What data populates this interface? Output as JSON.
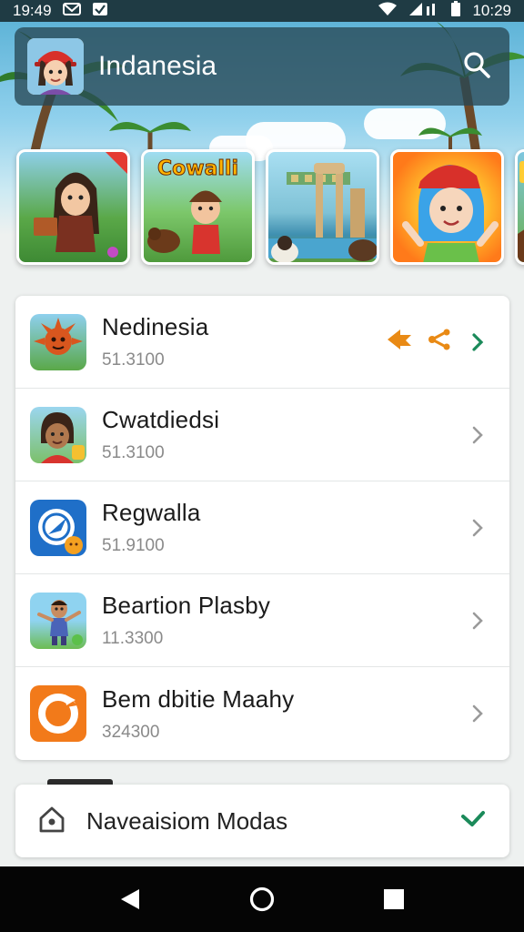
{
  "status_bar": {
    "time_left": "19:49",
    "time_right": "10:29",
    "icons": [
      "mail-icon",
      "check-icon",
      "wifi-icon",
      "signal-icon",
      "battery-icon"
    ]
  },
  "app_bar": {
    "title": "Indanesia",
    "search_icon": "search-icon"
  },
  "carousel": {
    "cards": [
      {
        "name": "girl-with-book",
        "label": ""
      },
      {
        "name": "cowalli",
        "label": "Cowalli"
      },
      {
        "name": "ruins-river",
        "label": ""
      },
      {
        "name": "blue-hair-girl",
        "label": ""
      },
      {
        "name": "partial-card",
        "label": ""
      }
    ]
  },
  "list": {
    "items": [
      {
        "title": "Nedinesia",
        "subtitle": "51.3100",
        "thumb": "sun-character",
        "actions": [
          "flag-icon",
          "share-icon"
        ]
      },
      {
        "title": "Cwatdiedsi",
        "subtitle": "51.3100",
        "thumb": "girl-avatar",
        "actions": []
      },
      {
        "title": "Regwalla",
        "subtitle": "51.9100",
        "thumb": "compass-app",
        "actions": []
      },
      {
        "title": "Beartion Plasby",
        "subtitle": "11.3300",
        "thumb": "boy-avatar",
        "actions": []
      },
      {
        "title": "Bem dbitie Maahy",
        "subtitle": "324300",
        "thumb": "orange-ring-app",
        "actions": []
      }
    ]
  },
  "selector": {
    "label": "Naveaisiom Modas",
    "icon": "home-icon",
    "check_icon": "check-icon"
  },
  "colors": {
    "app_bar": "#2d5563",
    "accent_green": "#1b8a5a",
    "accent_orange": "#e98a15"
  }
}
